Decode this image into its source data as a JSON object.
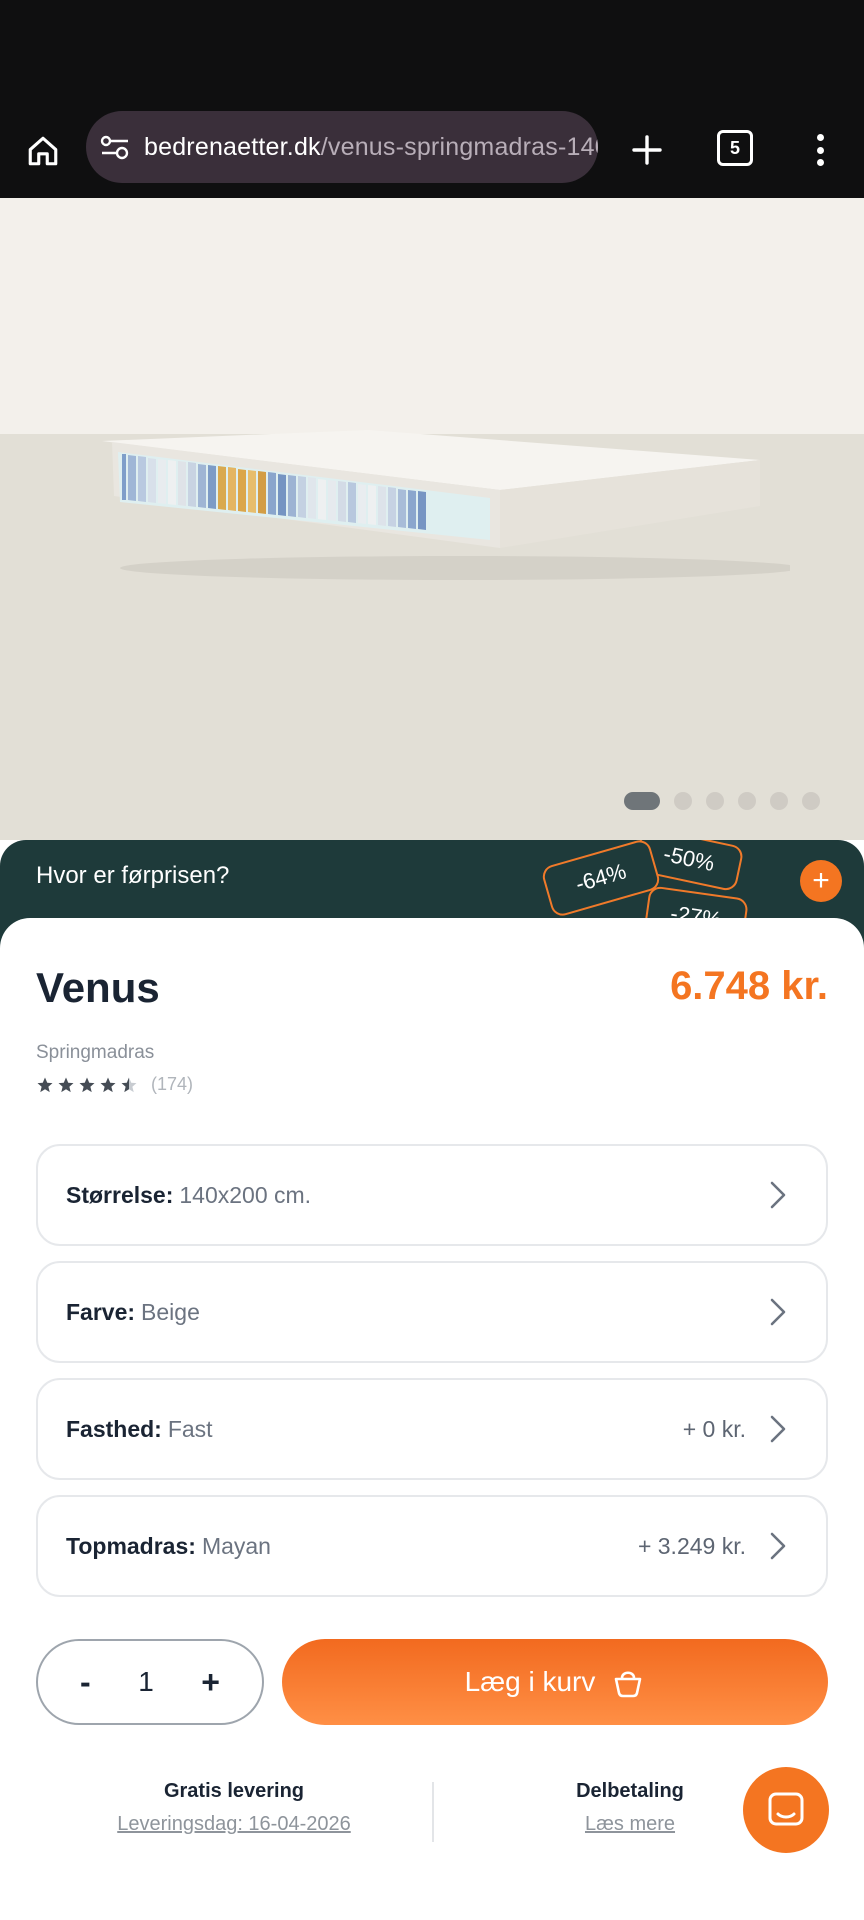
{
  "browser": {
    "url_domain": "bedrenaetter.dk",
    "url_path": "/venus-springmadras-140",
    "tab_count": "5",
    "icons": [
      "home-icon",
      "site-settings-icon",
      "new-tab-icon",
      "tab-switcher-icon",
      "menu-icon"
    ]
  },
  "gallery": {
    "slide_count": 6,
    "active_index": 0
  },
  "promo": {
    "text": "Hvor er førprisen?",
    "tags": [
      "-64%",
      "-50%",
      "-27%"
    ],
    "plus": "+"
  },
  "product": {
    "name": "Venus",
    "price": "6.748 kr.",
    "type": "Springmadras",
    "rating_stars": 4.5,
    "review_count": "(174)"
  },
  "options": [
    {
      "label": "Størrelse:",
      "value": "140x200 cm.",
      "extra": ""
    },
    {
      "label": "Farve:",
      "value": "Beige",
      "extra": ""
    },
    {
      "label": "Fasthed:",
      "value": "Fast",
      "extra": "+ 0 kr."
    },
    {
      "label": "Topmadras:",
      "value": "Mayan",
      "extra": "+ 3.249 kr."
    }
  ],
  "quantity": {
    "minus": "-",
    "value": "1",
    "plus": "+"
  },
  "cart": {
    "label": "Læg i kurv"
  },
  "delivery": {
    "title": "Gratis levering",
    "link": "Leveringsdag: 16-04-2026"
  },
  "payment": {
    "title": "Delbetaling",
    "link": "Læs mere"
  },
  "colors": {
    "accent": "#f47521",
    "promo_bg": "#1e3a3a",
    "text_dark": "#1a2433"
  }
}
